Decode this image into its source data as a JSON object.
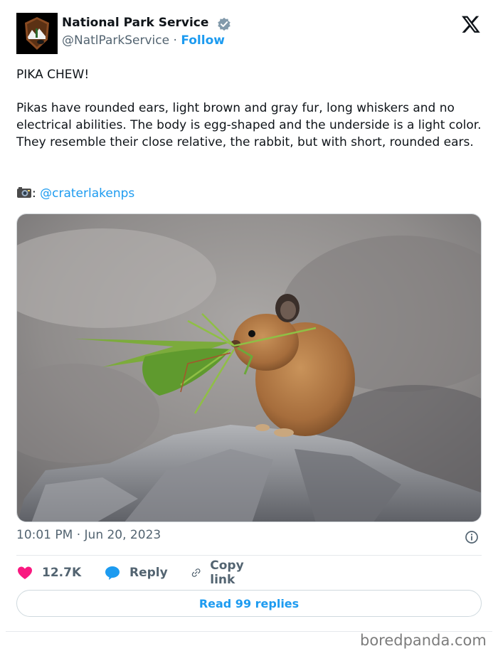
{
  "account": {
    "name": "National Park Service",
    "handle": "@NatlParkService",
    "separator": "·",
    "follow_label": "Follow",
    "verified": true
  },
  "tweet": {
    "title": "PIKA CHEW!",
    "body": "Pikas have rounded ears, light brown and gray fur, long whiskers and no electrical abilities. The body is egg-shaped and the underside is a light color. They resemble their close relative, the rabbit, but with short, rounded ears.",
    "credit_suffix": ":",
    "credit_handle": "@craterlakenps",
    "timestamp": "10:01 PM · Jun 20, 2023"
  },
  "actions": {
    "likes": "12.7K",
    "reply_label": "Reply",
    "copy_label": "Copy link",
    "read_replies_label": "Read 99 replies"
  },
  "icons": {
    "logo": "x-logo-icon",
    "avatar": "nps-arrowhead-logo",
    "verified": "verified-badge-icon",
    "heart": "heart-icon",
    "reply": "reply-bubble-icon",
    "copy": "link-icon",
    "info": "info-icon",
    "camera": "camera-emoji-icon"
  },
  "colors": {
    "link": "#1d9bf0",
    "heart": "#f91880",
    "muted": "#536471",
    "text": "#0f1419"
  },
  "watermark": "boredpanda.com"
}
